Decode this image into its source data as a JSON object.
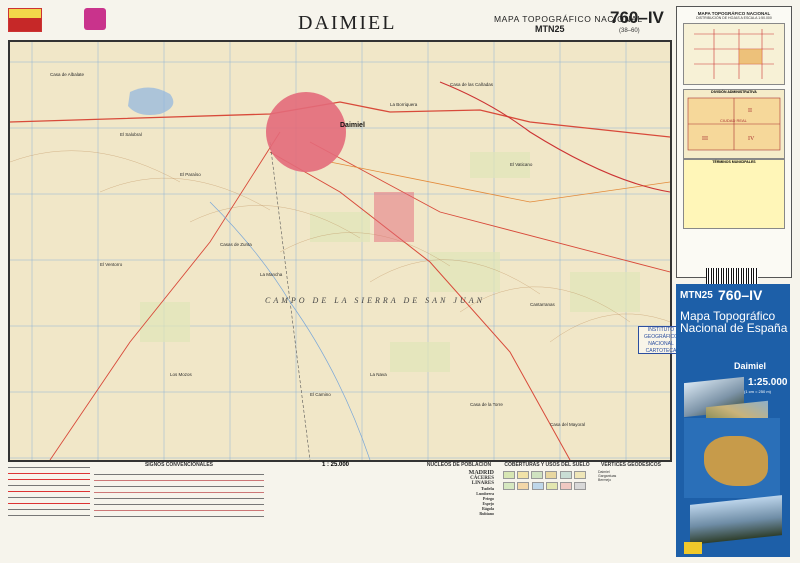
{
  "header": {
    "map_name": "DAIMIEL",
    "series": "MAPA TOPOGRÁFICO NACIONAL",
    "mtn": "MTN25",
    "sheet_number": "760–IV",
    "sheet_grid": "(38–60)"
  },
  "map": {
    "town_label": "Daimiel",
    "region_label": "CAMPO DE LA SIERRA DE SAN JUAN",
    "places": [
      "Casa de Albalate",
      "El Salobral",
      "El Paraíso",
      "La Borriquera",
      "Casa de las Cañadas",
      "El Vaticano",
      "Casas de Zurita",
      "La Mancha",
      "El Ventorro",
      "Cantarranas",
      "La Nava",
      "Los Mozos",
      "Casa de la Torre",
      "El Camino",
      "Casa del Mayoral"
    ],
    "colors": {
      "background": "#f1e7c8",
      "urban": "#e36a7a",
      "water": "#8fb5df",
      "roads": "#d84a3a",
      "contour": "#b07a44"
    }
  },
  "index_panel": {
    "title": "MAPA TOPOGRÁFICO NACIONAL",
    "subtitle": "DISTRIBUCIÓN DE HOJAS A ESCALA 1:50.000",
    "admin_title": "DIVISIÓN ADMINISTRATIVA",
    "province": "CIUDAD REAL",
    "quadrants": [
      "I",
      "II",
      "III",
      "IV"
    ],
    "municipal_title": "TÉRMINOS MUNICIPALES"
  },
  "cover": {
    "mtn": "MTN25",
    "number": "760–IV",
    "title": "Mapa Topográfico Nacional de España",
    "location": "Daimiel",
    "scale": "1:25.000",
    "scale_note": "(1 cm = 250 m)"
  },
  "stamp": {
    "line1": "INSTITUTO GEOGRÁFICO",
    "line2": "NACIONAL",
    "line3": "CARTOTECA"
  },
  "legend": {
    "signos_title": "SIGNOS CONVENCIONALES",
    "scale": "1 : 25.000",
    "nucleos_title": "NÚCLEOS DE POBLACIÓN",
    "nucleos_examples": [
      "MADRID",
      "CÁCERES",
      "LINARES",
      "Tudela",
      "Lumbrera",
      "Priego",
      "Espejo",
      "Rágola",
      "Rubiano"
    ],
    "coberturas_title": "COBERTURAS Y USOS DEL SUELO",
    "vertices_title": "VÉRTICES GEODÉSICOS",
    "vertices": [
      "Daimiel",
      "Gargantuas",
      "Bermejo"
    ]
  }
}
